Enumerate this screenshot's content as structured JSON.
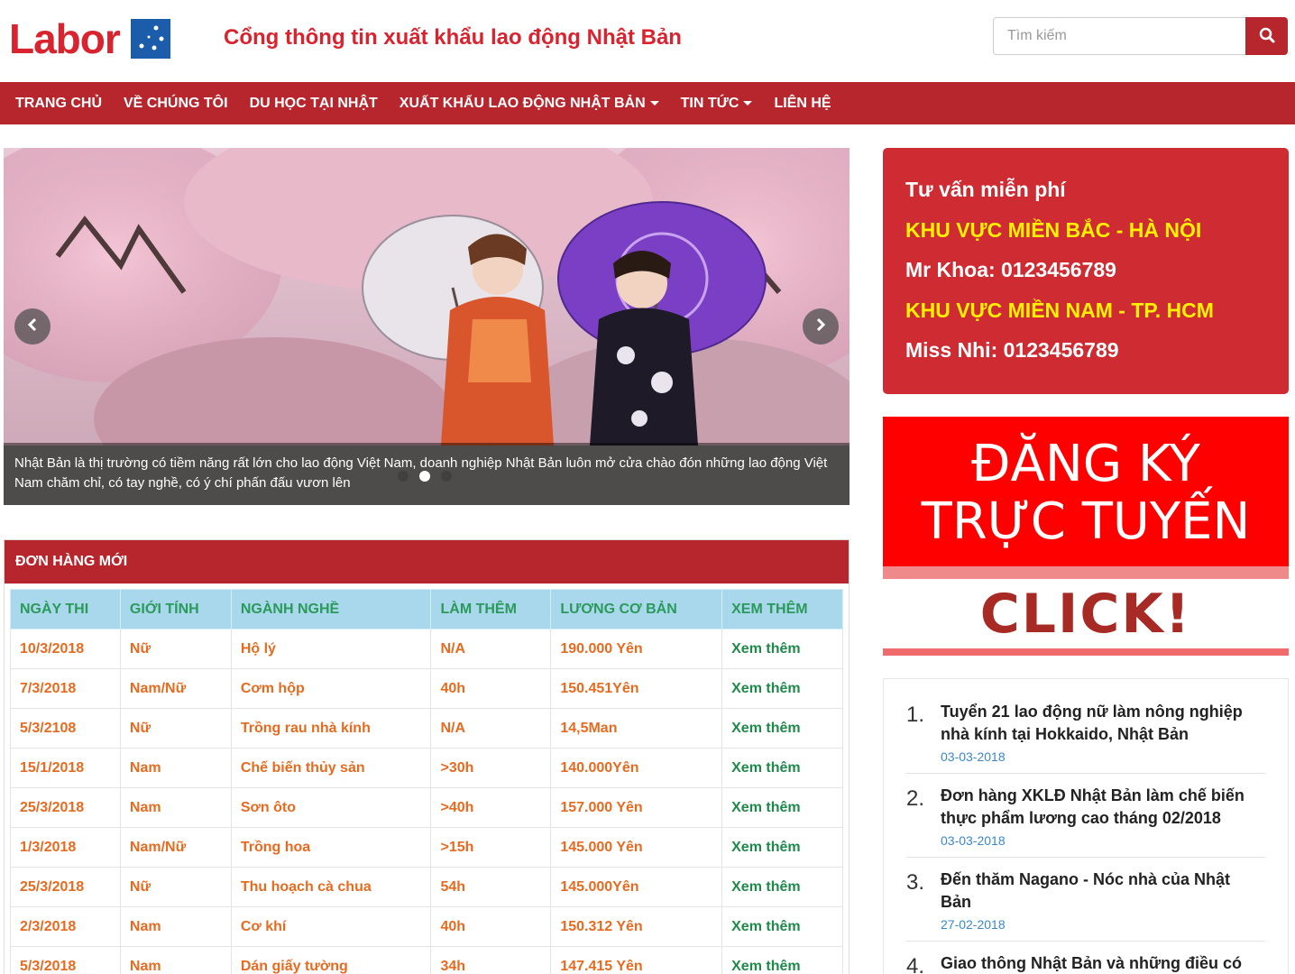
{
  "brand": {
    "logo_text": "Labor",
    "site_title": "Cổng thông tin xuất khẩu lao động Nhật Bản"
  },
  "search": {
    "placeholder": "Tìm kiếm",
    "icon": "search-icon"
  },
  "nav": {
    "items": [
      {
        "label": "TRANG CHỦ",
        "dropdown": false
      },
      {
        "label": "VỀ CHÚNG TÔI",
        "dropdown": false
      },
      {
        "label": "DU HỌC TẠI NHẬT",
        "dropdown": false
      },
      {
        "label": "XUẤT KHẨU LAO ĐỘNG NHẬT BẢN",
        "dropdown": true
      },
      {
        "label": "TIN TỨC",
        "dropdown": true
      },
      {
        "label": "LIÊN HỆ",
        "dropdown": false
      }
    ]
  },
  "carousel": {
    "caption": "Nhật Bản là thị trường có tiềm năng rất lớn cho lao động Việt Nam, doanh nghiệp Nhật Bản luôn mở cửa chào đón những lao động Việt Nam chăm chỉ, có tay nghề, có ý chí phấn đấu vươn lên",
    "slide_count": 3,
    "active_slide": 2
  },
  "orders": {
    "heading": "ĐƠN HÀNG MỚI",
    "columns": [
      "NGÀY THI",
      "GIỚI TÍNH",
      "NGÀNH NGHỀ",
      "LÀM THÊM",
      "LƯƠNG CƠ BẢN",
      "XEM THÊM"
    ],
    "rows": [
      [
        "10/3/2018",
        "Nữ",
        "Hộ lý",
        "N/A",
        "190.000 Yên",
        "Xem thêm"
      ],
      [
        "7/3/2018",
        "Nam/Nữ",
        "Cơm hộp",
        "40h",
        "150.451Yên",
        "Xem thêm"
      ],
      [
        "5/3/2108",
        "Nữ",
        "Trồng rau nhà kính",
        "N/A",
        "14,5Man",
        "Xem thêm"
      ],
      [
        "15/1/2018",
        "Nam",
        "Chế biến thủy sản",
        ">30h",
        "140.000Yên",
        "Xem thêm"
      ],
      [
        "25/3/2018",
        "Nam",
        "Sơn ôto",
        ">40h",
        "157.000 Yên",
        "Xem thêm"
      ],
      [
        "1/3/2018",
        "Nam/Nữ",
        "Trồng hoa",
        ">15h",
        "145.000 Yên",
        "Xem thêm"
      ],
      [
        "25/3/2018",
        "Nữ",
        "Thu hoạch cà chua",
        "54h",
        "145.000Yên",
        "Xem thêm"
      ],
      [
        "2/3/2018",
        "Nam",
        "Cơ khí",
        "40h",
        "150.312 Yên",
        "Xem thêm"
      ],
      [
        "5/3/2018",
        "Nam",
        "Dán giấy tường",
        "34h",
        "147.415 Yên",
        "Xem thêm"
      ]
    ]
  },
  "consult": {
    "title": "Tư vấn miễn phí",
    "north_region": "KHU VỰC MIỀN BẮC - HÀ NỘI",
    "north_contact": "Mr Khoa: 0123456789",
    "south_region": "KHU VỰC MIỀN NAM - TP. HCM",
    "south_contact": "Miss Nhi: 0123456789"
  },
  "register_banner": {
    "line1": "ĐĂNG KÝ",
    "line2": "TRỰC TUYẾN",
    "click": "CLICK!"
  },
  "news": [
    {
      "num": "1.",
      "title": "Tuyển 21 lao động nữ làm nông nghiệp nhà kính tại Hokkaido, Nhật Bản",
      "date": "03-03-2018"
    },
    {
      "num": "2.",
      "title": "Đơn hàng XKLĐ Nhật Bản làm chế biến thực phẩm lương cao tháng 02/2018",
      "date": "03-03-2018"
    },
    {
      "num": "3.",
      "title": "Đến thăm Nagano - Nóc nhà của Nhật Bản",
      "date": "27-02-2018"
    },
    {
      "num": "4.",
      "title": "Giao thông Nhật Bản và những điều có thể",
      "date": ""
    }
  ],
  "colors": {
    "brand_red": "#b8262d",
    "logo_red": "#d9232e",
    "consult_bg": "#cf2b32",
    "highlight_yellow": "#fff200",
    "table_header_bg": "#a9d8ec",
    "table_text_orange": "#e86a1f",
    "link_green": "#1e8a4a",
    "date_blue": "#3a88c9"
  }
}
